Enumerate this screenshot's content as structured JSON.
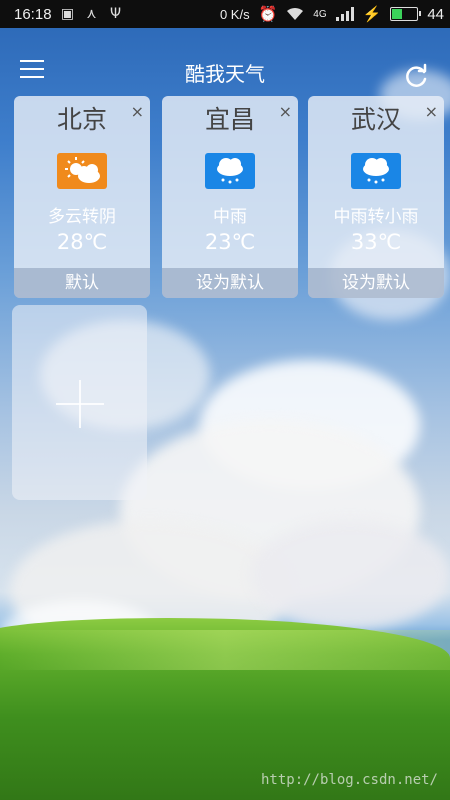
{
  "status_bar": {
    "time": "16:18",
    "net_speed": "0 K/s",
    "network": "4G",
    "battery_level": "44",
    "battery_fraction": 0.44
  },
  "header": {
    "title": "酷我天气"
  },
  "cards": [
    {
      "city": "北京",
      "condition": "多云转阴",
      "temperature": "28℃",
      "action": "默认",
      "icon": "partly-cloudy-icon",
      "icon_color": "#f08a1c"
    },
    {
      "city": "宜昌",
      "condition": "中雨",
      "temperature": "23℃",
      "action": "设为默认",
      "icon": "rain-icon",
      "icon_color": "#1a86e6"
    },
    {
      "city": "武汉",
      "condition": "中雨转小雨",
      "temperature": "33℃",
      "action": "设为默认",
      "icon": "rain-icon",
      "icon_color": "#1a86e6"
    }
  ],
  "close_glyph": "×",
  "watermark": "http://blog.csdn.net/"
}
